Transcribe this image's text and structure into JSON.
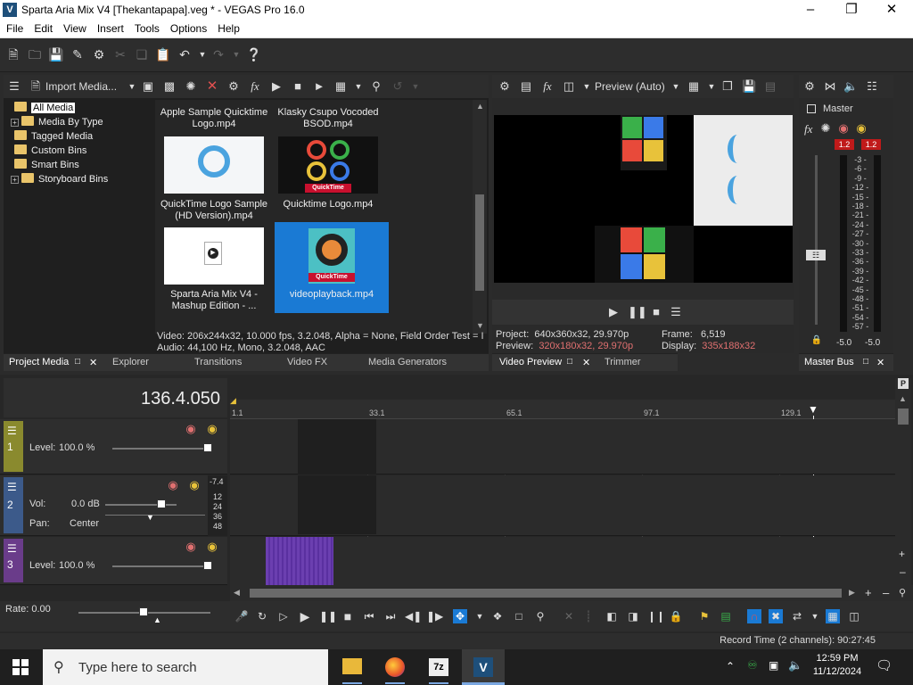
{
  "window": {
    "title": "Sparta Aria Mix V4 [Thekantapapa].veg * - VEGAS Pro 16.0",
    "app_icon": "V"
  },
  "menu": [
    "File",
    "Edit",
    "View",
    "Insert",
    "Tools",
    "Options",
    "Help"
  ],
  "media_panel": {
    "import_label": "Import Media...",
    "tree": [
      {
        "label": "All Media",
        "selected": true
      },
      {
        "label": "Media By Type",
        "expandable": true
      },
      {
        "label": "Tagged Media"
      },
      {
        "label": "Custom Bins"
      },
      {
        "label": "Smart Bins"
      },
      {
        "label": "Storyboard Bins",
        "expandable": true
      }
    ],
    "items": [
      {
        "name": "Apple Sample Quicktime Logo.mp4"
      },
      {
        "name": "Klasky Csupo Vocoded BSOD.mp4"
      },
      {
        "name": "QuickTime Logo Sample (HD Version).mp4"
      },
      {
        "name": "Quicktime Logo.mp4"
      },
      {
        "name": "Sparta Aria Mix V4 - Mashup Edition - ..."
      },
      {
        "name": "videoplayback.mp4",
        "selected": true
      }
    ],
    "thumb_text": "QuickTime",
    "info_video": "Video: 206x244x32, 10.000 fps, 3.2.048, Alpha = None, Field Order Test = I",
    "info_audio": "Audio: 44,100 Hz, Mono, 3.2.048, AAC"
  },
  "tabs_left": [
    "Project Media",
    "Explorer",
    "Transitions",
    "Video FX",
    "Media Generators"
  ],
  "preview": {
    "mode_label": "Preview (Auto)",
    "project_label": "Project:",
    "project_value": "640x360x32, 29.970p",
    "frame_label": "Frame:",
    "frame_value": "6,519",
    "preview_label": "Preview:",
    "preview_value": "320x180x32, 29.970p",
    "display_label": "Display:",
    "display_value": "335x188x32",
    "tab": "Video Preview",
    "tab2": "Trimmer"
  },
  "master": {
    "label": "Master",
    "peak_l": "1.2",
    "peak_r": "1.2",
    "scale": [
      "3",
      "6",
      "9",
      "12",
      "15",
      "18",
      "21",
      "24",
      "27",
      "30",
      "33",
      "36",
      "39",
      "42",
      "45",
      "48",
      "51",
      "54",
      "57"
    ],
    "bottom_l": "-5.0",
    "bottom_r": "-5.0",
    "tab": "Master Bus"
  },
  "timeline": {
    "time": "136.4.050",
    "ruler": [
      "1.1",
      "33.1",
      "65.1",
      "97.1",
      "129.1"
    ],
    "tracks": [
      {
        "num": "1",
        "level_label": "Level:",
        "level_value": "100.0 %"
      },
      {
        "num": "2",
        "vol_label": "Vol:",
        "vol_value": "0.0 dB",
        "pan_label": "Pan:",
        "pan_value": "Center",
        "meter_top": "-7.4",
        "meter_scale": [
          "12",
          "24",
          "36",
          "48"
        ]
      },
      {
        "num": "3",
        "level_label": "Level:",
        "level_value": "100.0 %"
      }
    ],
    "rate_label": "Rate: 0.00"
  },
  "status": {
    "record_time": "Record Time (2 channels): 90:27:45"
  },
  "taskbar": {
    "search_placeholder": "Type here to search",
    "time": "12:59 PM",
    "date": "11/12/2024"
  },
  "colors": {
    "track1": "#8a8a2e",
    "track2": "#3c5a8a",
    "track3": "#6a3c8a",
    "selection": "#1a7ad4",
    "clip3": "#6b3fb0"
  }
}
